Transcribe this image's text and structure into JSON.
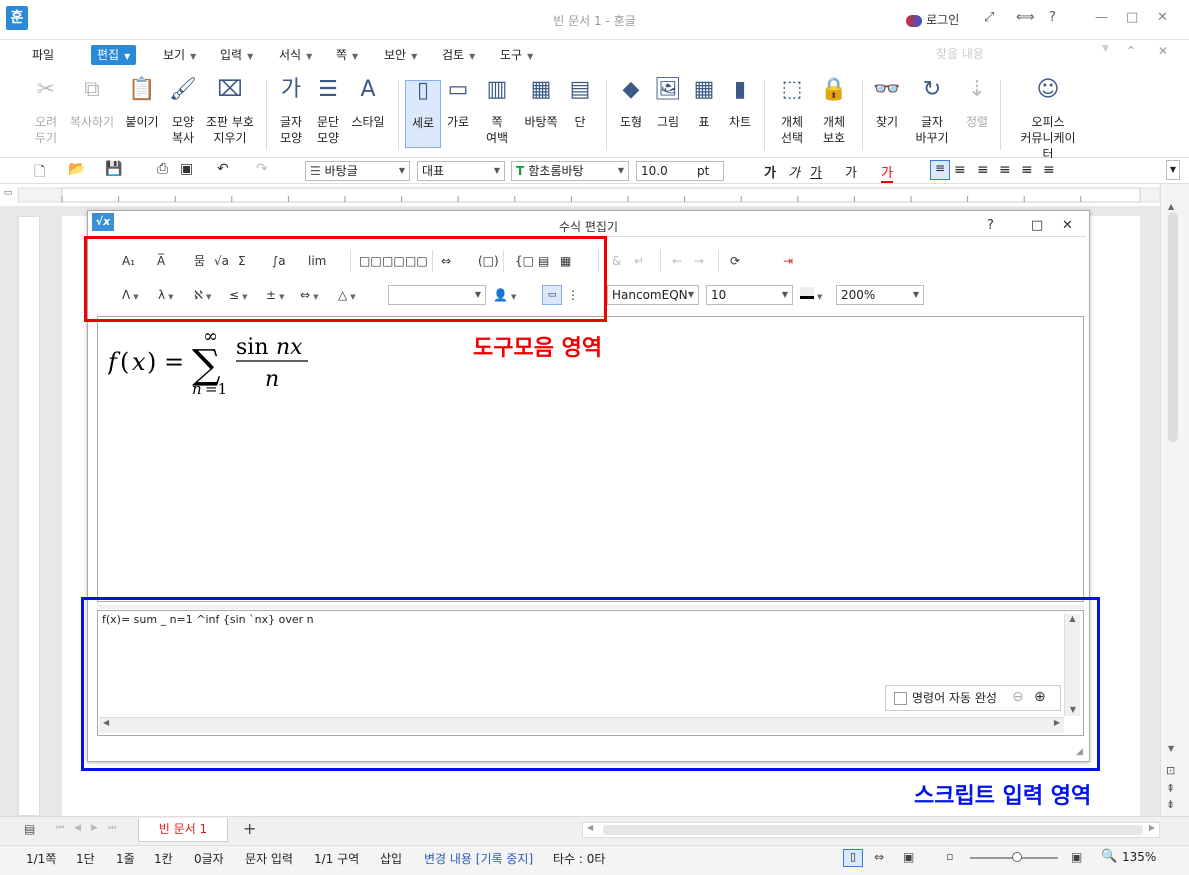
{
  "window": {
    "title": "빈 문서 1 - 훈글",
    "login": "로그인",
    "help": "?"
  },
  "menu": {
    "items": [
      "파일",
      "편집",
      "보기",
      "입력",
      "서식",
      "쪽",
      "보안",
      "검토",
      "도구"
    ],
    "search_placeholder": "찾을 내용"
  },
  "ribbon": {
    "buttons": [
      {
        "label": "오려\n두기",
        "icon": "scissors-icon",
        "enabled": false
      },
      {
        "label": "복사하기",
        "icon": "copy-icon",
        "enabled": false
      },
      {
        "label": "붙이기",
        "icon": "paste-icon",
        "enabled": true
      },
      {
        "label": "모양\n복사",
        "icon": "format-painter-icon",
        "enabled": true
      },
      {
        "label": "조판 부호\n지우기",
        "icon": "clear-codes-icon",
        "enabled": true
      },
      {
        "label": "글자\n모양",
        "icon": "char-shape-icon",
        "enabled": true
      },
      {
        "label": "문단\n모양",
        "icon": "para-shape-icon",
        "enabled": true
      },
      {
        "label": "스타일",
        "icon": "style-icon",
        "enabled": true
      },
      {
        "label": "세로",
        "icon": "portrait-icon",
        "enabled": true
      },
      {
        "label": "가로",
        "icon": "landscape-icon",
        "enabled": true
      },
      {
        "label": "쪽\n여백",
        "icon": "margin-icon",
        "enabled": true
      },
      {
        "label": "바탕쪽",
        "icon": "master-page-icon",
        "enabled": true
      },
      {
        "label": "단",
        "icon": "columns-icon",
        "enabled": true
      },
      {
        "label": "도형",
        "icon": "shape-icon",
        "enabled": true
      },
      {
        "label": "그림",
        "icon": "picture-icon",
        "enabled": true
      },
      {
        "label": "표",
        "icon": "table-icon",
        "enabled": true
      },
      {
        "label": "차트",
        "icon": "chart-icon",
        "enabled": true
      },
      {
        "label": "개체\n선택",
        "icon": "select-object-icon",
        "enabled": true
      },
      {
        "label": "개체\n보호",
        "icon": "protect-object-icon",
        "enabled": true
      },
      {
        "label": "찾기",
        "icon": "binoculars-icon",
        "enabled": true
      },
      {
        "label": "글자\n바꾸기",
        "icon": "replace-icon",
        "enabled": true
      },
      {
        "label": "정렬",
        "icon": "sort-icon",
        "enabled": false
      },
      {
        "label": "오피스\n커뮤니케이터",
        "icon": "communicator-icon",
        "enabled": true
      }
    ]
  },
  "format_bar": {
    "style": "바탕글",
    "lang": "대표",
    "font": "함초롬바탕",
    "size": "10.0",
    "unit": "pt",
    "bold": "가",
    "italic": "가",
    "underline": "가",
    "strike": "가",
    "color": "가"
  },
  "dialog": {
    "title": "수식 편집기",
    "help": "?",
    "font": "HancomEQN",
    "font_size": "10",
    "zoom": "200%",
    "script": "f(x)= sum _ n=1 ^inf {sin `nx} over n",
    "autocomplete_label": "명령어 자동 완성"
  },
  "toolbar_row1": [
    "A₁",
    "A̅",
    "뭄",
    "√a",
    "Σ",
    "∫a",
    "lim",
    "□□",
    "□□",
    "□□",
    "⇔",
    "(□)",
    "{□",
    "▤",
    "▦",
    "&",
    "↵",
    "←",
    "→"
  ],
  "toolbar_row2": [
    "Λ",
    "λ",
    "ℵ",
    "≤",
    "±",
    "⇔",
    "△"
  ],
  "annotations": {
    "toolbar_area": "도구모음 영역",
    "script_area": "스크립트 입력 영역"
  },
  "tabs": {
    "doc": "빈 문서 1",
    "add": "+"
  },
  "status": {
    "page": "1/1쪽",
    "col": "1단",
    "line": "1줄",
    "ch": "1칸",
    "chars": "0글자",
    "mode": "문자 입력",
    "section": "1/1 구역",
    "insert": "삽입",
    "track": "변경 내용 [기록 중지]",
    "strokes": "타수 : 0타",
    "zoom": "135%"
  }
}
